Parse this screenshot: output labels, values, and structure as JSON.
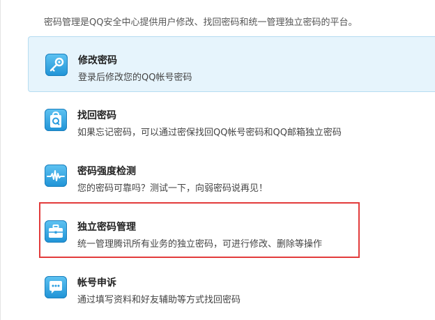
{
  "intro": "密码管理是QQ安全中心提供用户修改、找回密码和统一管理独立密码的平台。",
  "items": [
    {
      "title": "修改密码",
      "desc": "登录后修改您的QQ帐号密码",
      "icon": "key-icon"
    },
    {
      "title": "找回密码",
      "desc": "如果忘记密码，可以通过密保找回QQ帐号密码和QQ邮箱独立密码",
      "icon": "bag-q-icon"
    },
    {
      "title": "密码强度检测",
      "desc": "您的密码可靠吗？测试一下，向弱密码说再见！",
      "icon": "pulse-icon"
    },
    {
      "title": "独立密码管理",
      "desc": "统一管理腾讯所有业务的独立密码，可进行修改、删除等操作",
      "icon": "briefcase-icon"
    },
    {
      "title": "帐号申诉",
      "desc": "通过填写资料和好友辅助等方式找回密码",
      "icon": "chat-bubble-icon"
    }
  ],
  "colors": {
    "active_bg": "#e6f4fc",
    "icon_blue": "#2a9de0",
    "highlight_border": "#e23b3b"
  }
}
